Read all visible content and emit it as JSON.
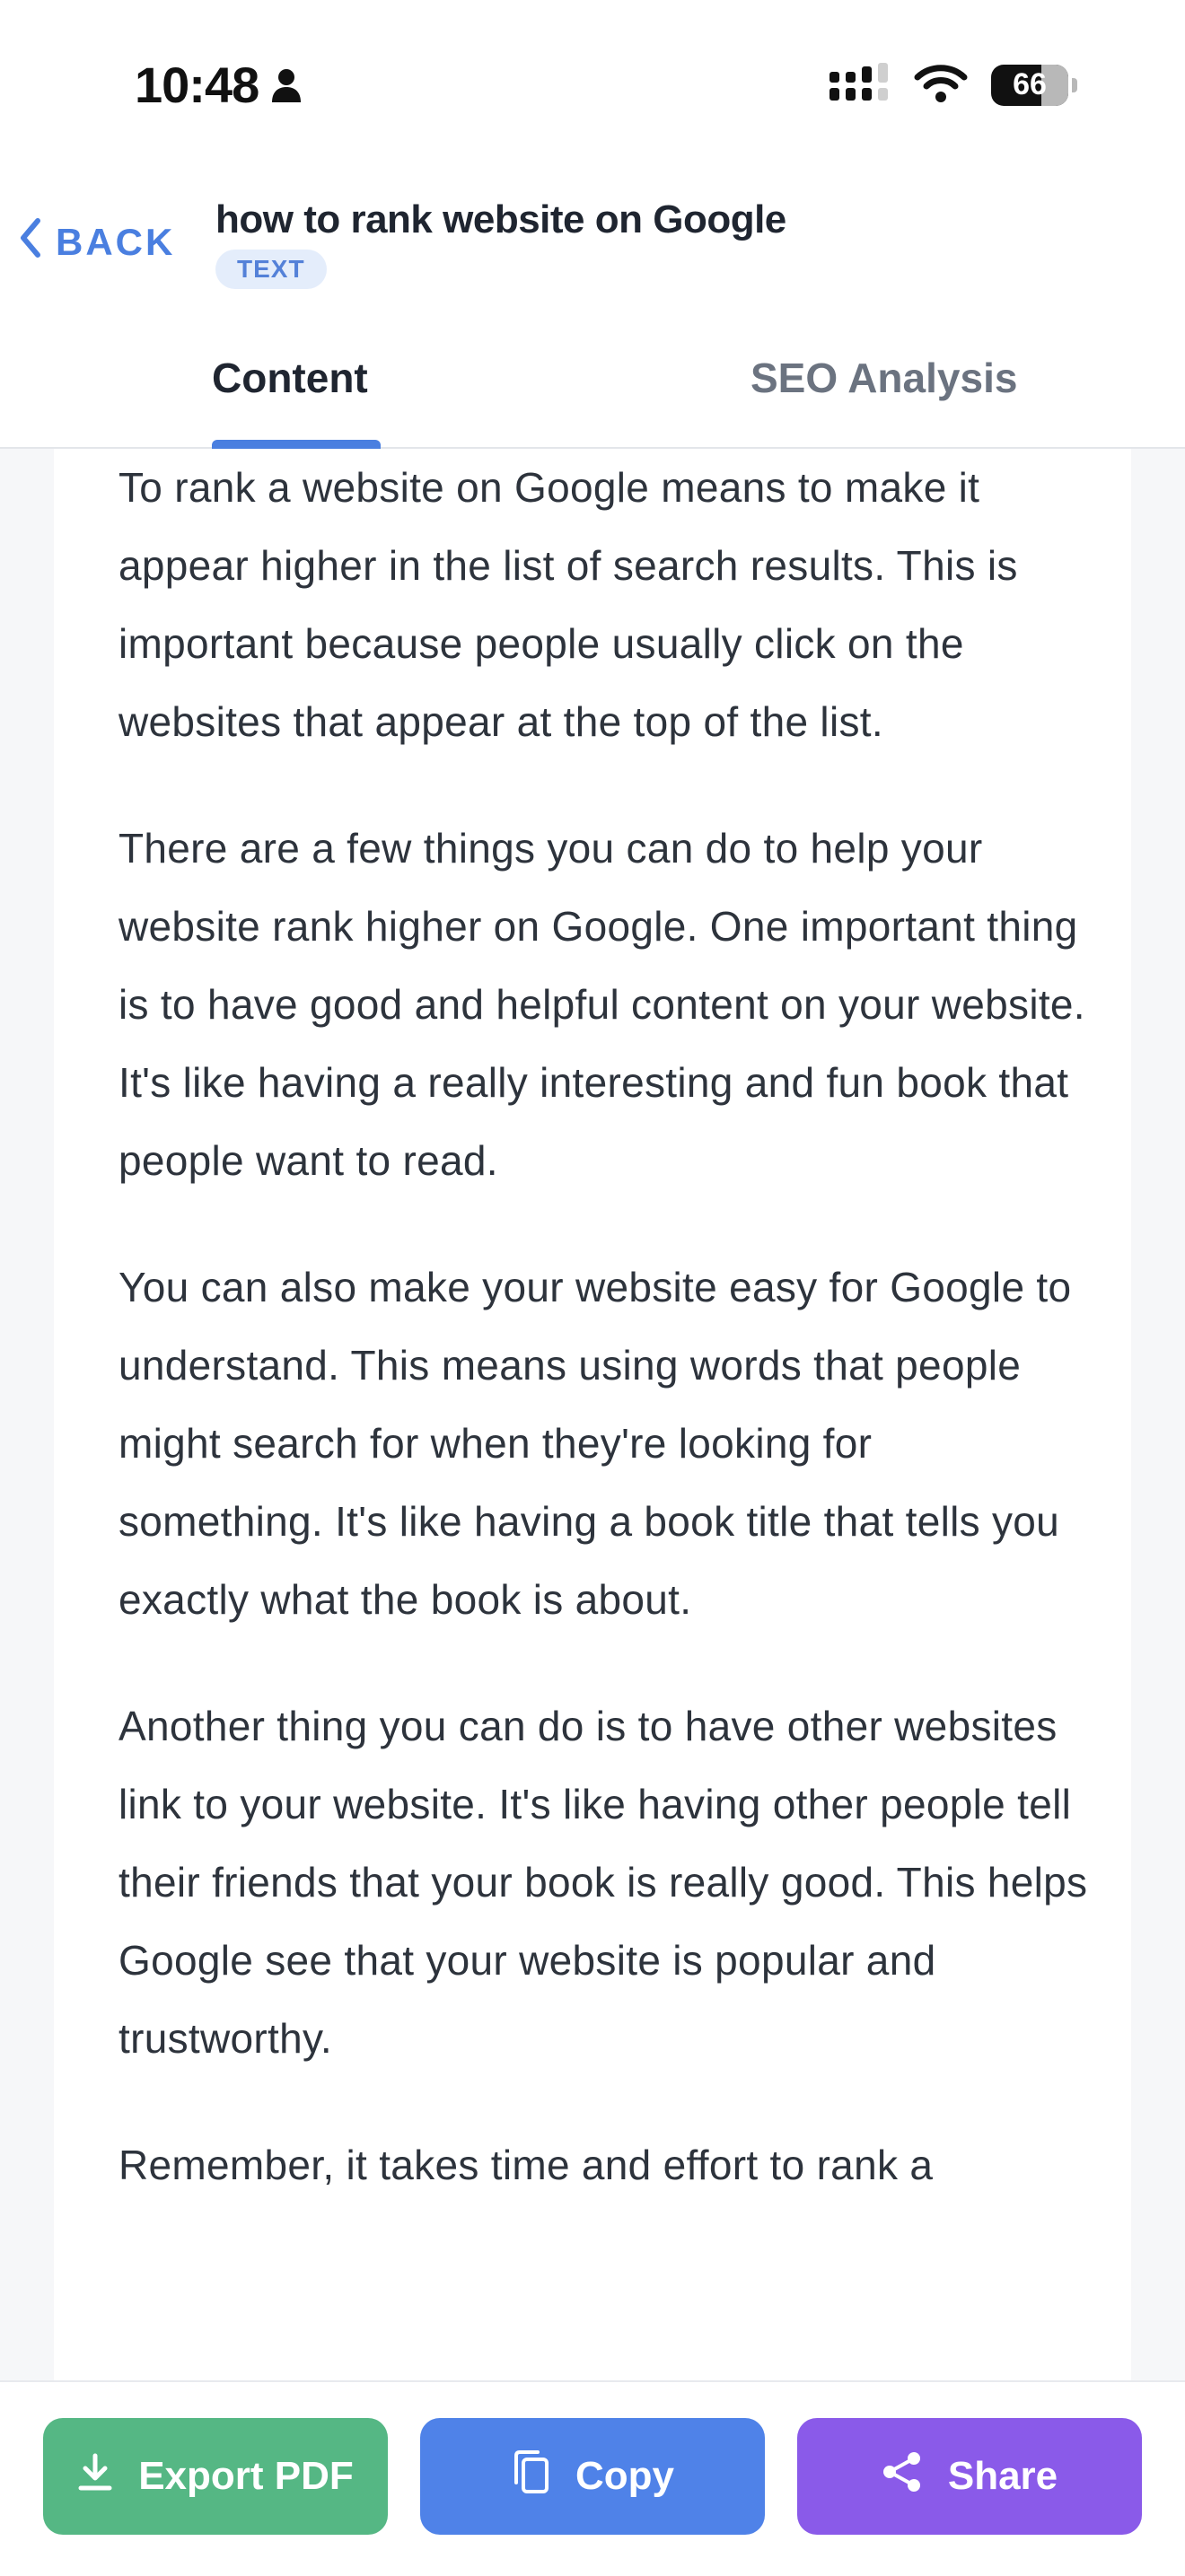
{
  "status_bar": {
    "time": "10:48",
    "battery": "66"
  },
  "header": {
    "back_label": "BACK",
    "title": "how to rank website on Google",
    "type_badge": "TEXT"
  },
  "tabs": [
    {
      "label": "Content",
      "active": true
    },
    {
      "label": "SEO Analysis",
      "active": false
    }
  ],
  "content": {
    "paragraphs": [
      "To rank a website on Google means to make it appear higher in the list of search results. This is important because people usually click on the websites that appear at the top of the list.",
      "There are a few things you can do to help your website rank higher on Google. One important thing is to have good and helpful content on your website. It's like having a really interesting and fun book that people want to read.",
      "You can also make your website easy for Google to understand. This means using words that people might search for when they're looking for something. It's like having a book title that tells you exactly what the book is about.",
      "Another thing you can do is to have other websites link to your website. It's like having other people tell their friends that your book is really good. This helps Google see that your website is popular and trustworthy.",
      "Remember, it takes time and effort to rank a"
    ]
  },
  "actions": {
    "export_label": "Export PDF",
    "copy_label": "Copy",
    "share_label": "Share"
  },
  "colors": {
    "accent": "#4a7fe0",
    "export": "#55b784",
    "copy": "#4f82e8",
    "share": "#8a5ae9"
  },
  "icons": {
    "person": "person-icon",
    "signal": "cellular-signal-icon",
    "wifi": "wifi-icon",
    "battery": "battery-icon",
    "back": "chevron-left-icon",
    "download": "download-icon",
    "copy": "copy-icon",
    "share": "share-icon"
  }
}
